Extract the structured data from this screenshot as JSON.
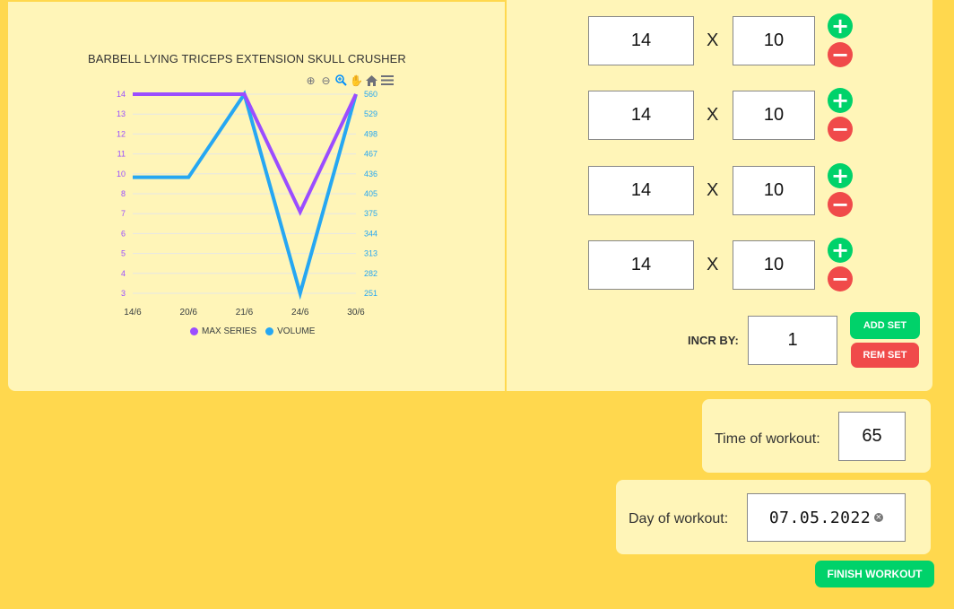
{
  "chart_data": {
    "type": "line",
    "title": "BARBELL LYING TRICEPS EXTENSION SKULL CRUSHER",
    "categories": [
      "14/6",
      "20/6",
      "21/6",
      "24/6",
      "30/6"
    ],
    "series": [
      {
        "name": "MAX SERIES",
        "color": "#9b4dff",
        "axis": "left",
        "values": [
          14,
          14,
          14,
          7.5,
          14
        ]
      },
      {
        "name": "VOLUME",
        "color": "#26a7f2",
        "axis": "right",
        "values": [
          431,
          431,
          560,
          251,
          560
        ]
      }
    ],
    "y_left": {
      "ticks": [
        "14",
        "13",
        "12",
        "11",
        "10",
        "8",
        "7",
        "6",
        "5",
        "4",
        "3"
      ],
      "range": [
        3,
        14
      ],
      "color": "#9b4dff"
    },
    "y_right": {
      "ticks": [
        "560",
        "529",
        "498",
        "467",
        "436",
        "405",
        "375",
        "344",
        "313",
        "282",
        "251"
      ],
      "range": [
        251,
        560
      ],
      "color": "#26a7f2"
    },
    "grid": true,
    "legend_position": "bottom"
  },
  "toolbar_icons": [
    "zoom-in-icon",
    "zoom-out-icon",
    "selection-zoom-icon",
    "pan-hand-icon",
    "home-icon",
    "menu-icon"
  ],
  "sets": [
    {
      "weight": "14",
      "reps": "10",
      "x": "X"
    },
    {
      "weight": "14",
      "reps": "10",
      "x": "X"
    },
    {
      "weight": "14",
      "reps": "10",
      "x": "X"
    },
    {
      "weight": "14",
      "reps": "10",
      "x": "X"
    }
  ],
  "increment": {
    "label": "INCR BY:",
    "value": "1"
  },
  "buttons": {
    "add_set": "ADD SET",
    "rem_set": "REM SET",
    "finish": "FINISH WORKOUT"
  },
  "time": {
    "label": "Time of workout:",
    "value": "65"
  },
  "day": {
    "label": "Day of workout:",
    "value": "07.05.2022"
  },
  "colors": {
    "background": "#ffd84e",
    "panel": "#fff5b8",
    "green": "#00d26a",
    "red": "#f04a4a"
  }
}
